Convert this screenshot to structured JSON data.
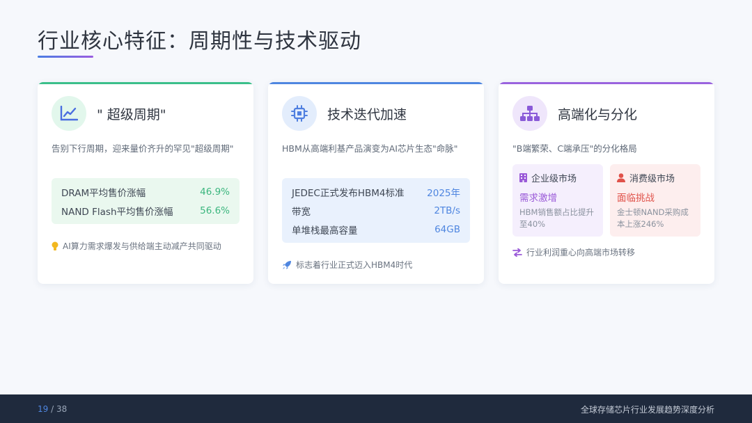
{
  "page_title": "行业核心特征：周期性与技术驱动",
  "cards": [
    {
      "icon": "line-chart-icon",
      "title": "\" 超级周期\"",
      "description": "告别下行周期，迎来量价齐升的罕见\"超级周期\"",
      "stats": [
        {
          "label": "DRAM平均售价涨幅",
          "value": "46.9%"
        },
        {
          "label": "NAND Flash平均售价涨幅",
          "value": "56.6%"
        }
      ],
      "footnote_icon": "lightbulb-icon",
      "footnote": "AI算力需求爆发与供给端主动减产共同驱动"
    },
    {
      "icon": "chip-icon",
      "title": "技术迭代加速",
      "description": "HBM从高端利基产品演变为AI芯片生态\"命脉\"",
      "stats": [
        {
          "label": "JEDEC正式发布HBM4标准",
          "value": "2025年"
        },
        {
          "label": "带宽",
          "value": "2TB/s"
        },
        {
          "label": "单堆栈最高容量",
          "value": "64GB"
        }
      ],
      "footnote_icon": "rocket-icon",
      "footnote": "标志着行业正式迈入HBM4时代"
    },
    {
      "icon": "hierarchy-icon",
      "title": "高端化与分化",
      "description": "\"B端繁荣、C端承压\"的分化格局",
      "enterprise": {
        "icon": "building-icon",
        "label": "企业级市场",
        "headline": "需求激增",
        "detail": "HBM销售额占比提升至40%"
      },
      "consumer": {
        "icon": "user-icon",
        "label": "消费级市场",
        "headline": "面临挑战",
        "detail": "金士顿NAND采购成本上涨246%"
      },
      "footnote_icon": "exchange-icon",
      "footnote": "行业利润重心向高端市场转移"
    }
  ],
  "footer": {
    "current_page": "19",
    "total_pages": "/ 38",
    "deck_title": "全球存储芯片行业发展趋势深度分析"
  },
  "colors": {
    "green": "#3bb67e",
    "blue": "#4f86e0",
    "purple": "#9a63de",
    "red": "#e0524a",
    "footer_bg": "#1f2a3d"
  }
}
